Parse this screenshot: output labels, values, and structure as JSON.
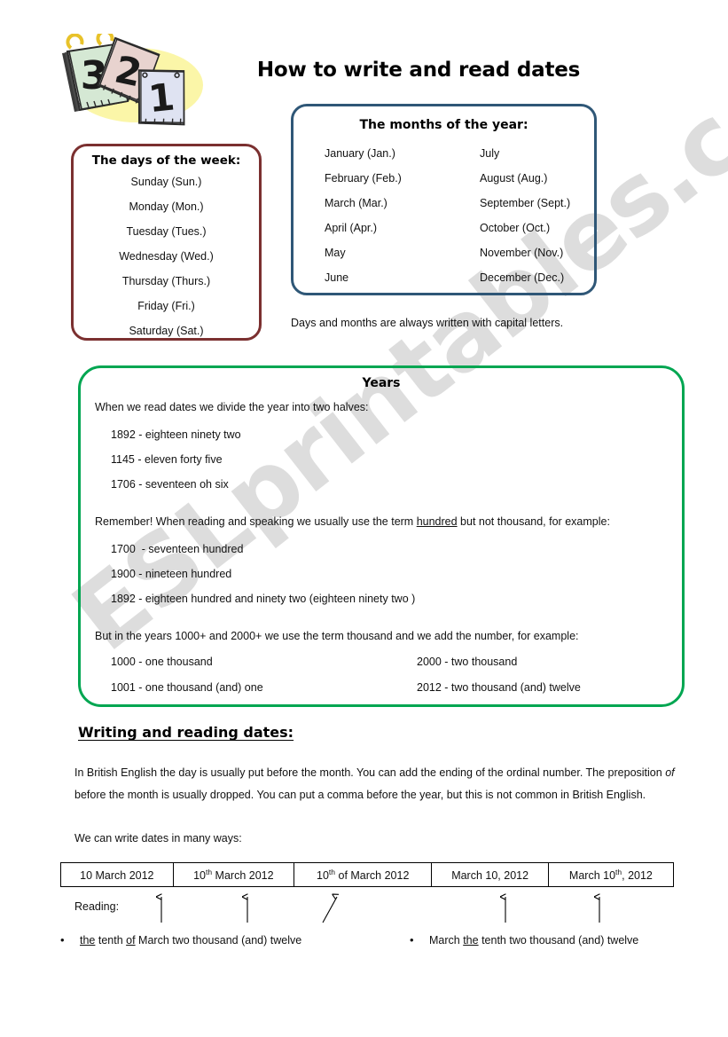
{
  "title": "How to write and read dates",
  "watermark": "ESLprintables.com",
  "clipart": {
    "name": "calendar-pages-clipart",
    "numbers": [
      "3",
      "2",
      "1"
    ]
  },
  "days_box": {
    "heading": "The days of the week:",
    "items": [
      "Sunday (Sun.)",
      "Monday (Mon.)",
      "Tuesday (Tues.)",
      "Wednesday (Wed.)",
      "Thursday (Thurs.)",
      "Friday (Fri.)",
      "Saturday (Sat.)"
    ]
  },
  "months_box": {
    "heading": "The months of the year:",
    "left_column": [
      "January (Jan.)",
      "February (Feb.)",
      "March (Mar.)",
      "April (Apr.)",
      "May",
      "June"
    ],
    "right_column": [
      "July",
      "August (Aug.)",
      "September (Sept.)",
      "October (Oct.)",
      "November (Nov.)",
      "December (Dec.)"
    ]
  },
  "capital_note": "Days and months are always written with capital letters.",
  "years_box": {
    "heading": "Years",
    "intro": "When we read dates we divide the year into two halves:",
    "halves_examples": [
      "1892 - eighteen ninety two",
      "1145 - eleven forty five",
      "1706 - seventeen oh six"
    ],
    "remember_before": "Remember! When reading and speaking we usually use the term ",
    "remember_underlined": "hundred",
    "remember_after": " but not thousand, for example:",
    "hundred_examples": [
      "1700  - seventeen hundred",
      "1900 - nineteen hundred",
      "1892 - eighteen hundred and ninety two (eighteen ninety two )"
    ],
    "thousand_intro": "But in the years 1000+ and 2000+ we use the term thousand and we add the number, for example:",
    "thousand_left": [
      "1000 - one thousand",
      "1001 - one thousand (and) one"
    ],
    "thousand_right": [
      "2000 - two thousand",
      "2012 - two thousand (and) twelve"
    ]
  },
  "writing_section": {
    "heading": "Writing and reading dates:",
    "para_part1": "In British English the day is usually put before the month.  You can add the ending of the ordinal number. The preposition ",
    "para_italic": "of",
    "para_part2": " before the month is usually dropped. You can put a comma before the year, but this is not common in British English.",
    "ways_line": "We can write dates in many ways:"
  },
  "dates_table": {
    "cells": [
      {
        "day": "10",
        "sup": "",
        "rest": " March 2012"
      },
      {
        "day": "10",
        "sup": "th",
        "rest": " March 2012"
      },
      {
        "day": "10",
        "sup": "th",
        "rest": " of March 2012"
      },
      {
        "day": "March 10, 2012",
        "sup": "",
        "rest": ""
      },
      {
        "day": "March 10",
        "sup": "th",
        "rest": ", 2012"
      }
    ]
  },
  "reading": {
    "label": "Reading:",
    "bullets": [
      {
        "dot": "•",
        "segments": [
          {
            "text": "the",
            "underline": true
          },
          {
            "text": " tenth ",
            "underline": false
          },
          {
            "text": "of",
            "underline": true
          },
          {
            "text": " March two thousand (and) twelve",
            "underline": false
          }
        ]
      },
      {
        "dot": "•",
        "segments": [
          {
            "text": "March ",
            "underline": false
          },
          {
            "text": "the",
            "underline": true
          },
          {
            "text": " tenth two thousand (and) twelve",
            "underline": false
          }
        ]
      }
    ]
  },
  "colors": {
    "days_border": "#7b3030",
    "months_border": "#2f5777",
    "years_border": "#00a651",
    "text": "#111111",
    "watermark": "#c9c9c9"
  }
}
